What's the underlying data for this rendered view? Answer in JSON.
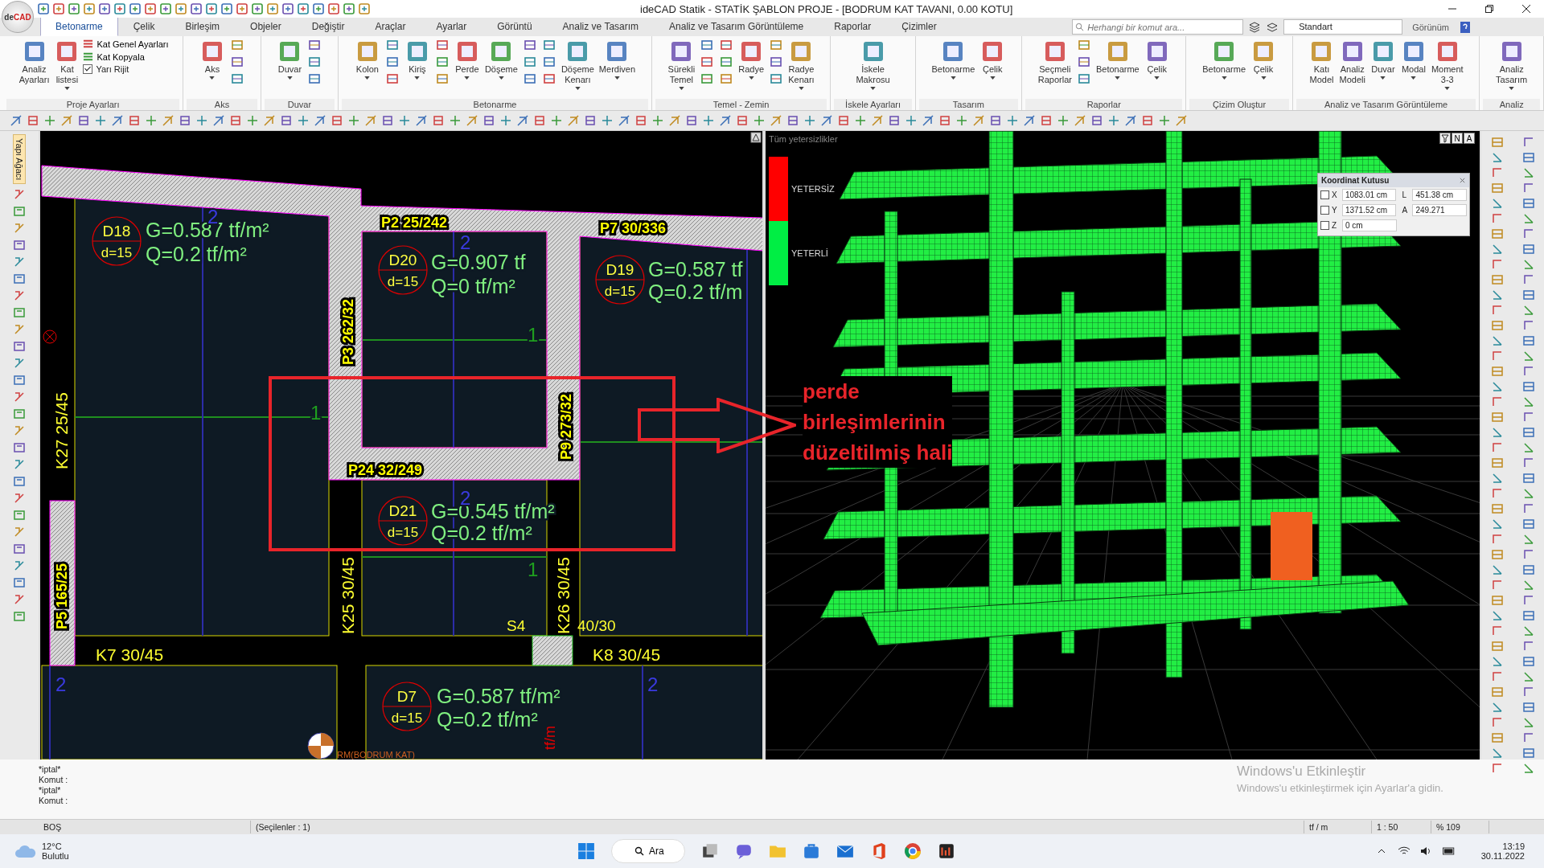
{
  "title_bar": {
    "logo": {
      "prefix": "de",
      "name": "CAD"
    },
    "title": "ideCAD Statik - STATİK ŞABLON PROJE - [BODRUM KAT TAVANI,  0.00 KOTU]"
  },
  "tabs": [
    {
      "label": "Betonarme",
      "selected": true
    },
    {
      "label": "Çelik",
      "selected": false
    },
    {
      "label": "Birleşim",
      "selected": false
    },
    {
      "label": "Objeler",
      "selected": false
    },
    {
      "label": "Değiştir",
      "selected": false
    },
    {
      "label": "Araçlar",
      "selected": false
    },
    {
      "label": "Ayarlar",
      "selected": false
    },
    {
      "label": "Görüntü",
      "selected": false
    },
    {
      "label": "Analiz ve Tasarım",
      "selected": false
    },
    {
      "label": "Analiz ve Tasarım Görüntüleme",
      "selected": false
    },
    {
      "label": "Raporlar",
      "selected": false
    },
    {
      "label": "Çizimler",
      "selected": false
    }
  ],
  "search": {
    "placeholder": "Herhangi bir komut ara..."
  },
  "style_combo": {
    "value": "Standart"
  },
  "view_menu": {
    "label": "Görünüm"
  },
  "ribbon": [
    {
      "label": "Proje Ayarları",
      "items": [
        {
          "kind": "large",
          "label": "Analiz\nAyarları",
          "dropdown": false
        },
        {
          "kind": "large",
          "label": "Kat\nlistesi",
          "dropdown": true
        },
        {
          "kind": "stack",
          "entries": [
            {
              "kind": "small",
              "label": "Kat Genel Ayarları"
            },
            {
              "kind": "small",
              "label": "Kat Kopyala"
            },
            {
              "kind": "check",
              "label": "Yarı Rijit",
              "checked": true
            }
          ]
        }
      ]
    },
    {
      "label": "Aks",
      "items": [
        {
          "kind": "large",
          "label": "Aks",
          "dropdown": true
        },
        {
          "kind": "icons"
        }
      ]
    },
    {
      "label": "Duvar",
      "items": [
        {
          "kind": "large",
          "label": "Duvar",
          "dropdown": true
        },
        {
          "kind": "icons"
        }
      ]
    },
    {
      "label": "Betonarme",
      "items": [
        {
          "kind": "large",
          "label": "Kolon",
          "dropdown": true
        },
        {
          "kind": "icons"
        },
        {
          "kind": "large",
          "label": "Kiriş",
          "dropdown": true
        },
        {
          "kind": "icons"
        },
        {
          "kind": "large",
          "label": "Perde",
          "dropdown": true
        },
        {
          "kind": "large",
          "label": "Döşeme",
          "dropdown": true
        },
        {
          "kind": "icons"
        },
        {
          "kind": "icons"
        },
        {
          "kind": "large",
          "label": "Döşeme\nKenarı",
          "dropdown": true
        },
        {
          "kind": "large",
          "label": "Merdiven",
          "dropdown": true
        }
      ]
    },
    {
      "label": "Temel - Zemin",
      "items": [
        {
          "kind": "large",
          "label": "Sürekli\nTemel",
          "dropdown": true
        },
        {
          "kind": "icons"
        },
        {
          "kind": "icons"
        },
        {
          "kind": "large",
          "label": "Radye",
          "dropdown": true
        },
        {
          "kind": "icons"
        },
        {
          "kind": "large",
          "label": "Radye\nKenarı",
          "dropdown": true
        }
      ]
    },
    {
      "label": "İskele Ayarları",
      "items": [
        {
          "kind": "large",
          "label": "İskele\nMakrosu",
          "dropdown": true
        }
      ]
    },
    {
      "label": "Tasarım",
      "items": [
        {
          "kind": "large",
          "label": "Betonarme",
          "dropdown": true
        },
        {
          "kind": "large",
          "label": "Çelik",
          "dropdown": true
        }
      ]
    },
    {
      "label": "Raporlar",
      "items": [
        {
          "kind": "large",
          "label": "Seçmeli\nRaporlar",
          "dropdown": false
        },
        {
          "kind": "icons"
        },
        {
          "kind": "large",
          "label": "Betonarme",
          "dropdown": true
        },
        {
          "kind": "large",
          "label": "Çelik",
          "dropdown": true
        }
      ]
    },
    {
      "label": "Çizim Oluştur",
      "items": [
        {
          "kind": "large",
          "label": "Betonarme",
          "dropdown": true
        },
        {
          "kind": "large",
          "label": "Çelik",
          "dropdown": true
        }
      ]
    },
    {
      "label": "Analiz ve Tasarım Görüntüleme",
      "items": [
        {
          "kind": "large",
          "label": "Katı\nModel",
          "dropdown": false
        },
        {
          "kind": "large",
          "label": "Analiz\nModeli",
          "dropdown": false
        },
        {
          "kind": "large",
          "label": "Duvar",
          "dropdown": true
        },
        {
          "kind": "large",
          "label": "Modal",
          "dropdown": true
        },
        {
          "kind": "large",
          "label": "Moment\n3-3",
          "dropdown": true
        }
      ]
    },
    {
      "label": "Analiz",
      "items": [
        {
          "kind": "large",
          "label": "Analiz\nTasarım",
          "dropdown": true
        }
      ]
    }
  ],
  "side_tab": {
    "label": "Yapı Ağacı"
  },
  "plan_view": {
    "slabs": [
      {
        "id": "D18",
        "thickness": "d=15",
        "g": "G=0.587 tf/m²",
        "q": "Q=0.2 tf/m²"
      },
      {
        "id": "D20",
        "thickness": "d=15",
        "g": "G=0.907 tf",
        "q": "Q=0 tf/m²"
      },
      {
        "id": "D19",
        "thickness": "d=15",
        "g": "G=0.587 tf",
        "q": "Q=0.2 tf/m"
      },
      {
        "id": "D21",
        "thickness": "d=15",
        "g": "G=0.545 tf/m²",
        "q": "Q=0.2 tf/m²"
      },
      {
        "id": "D7",
        "thickness": "d=15",
        "g": "G=0.587 tf/m²",
        "q": "Q=0.2 tf/m²"
      }
    ],
    "beams": [
      "K27 25/45",
      "K25 30/45",
      "K26 30/45",
      "K7 30/45",
      "K8 30/45"
    ],
    "walls": [
      "P2 25/242",
      "P7 30/336",
      "P3 262/32",
      "P9 273/32",
      "P24 32/249",
      "P5 165/25"
    ],
    "labels": [
      "S4",
      "40/30"
    ],
    "span_marks": [
      "2",
      "2",
      "1",
      "1",
      "2",
      "1",
      "2",
      "2"
    ],
    "unit_label": "tf/m",
    "floor_label": "RM(BODRUM KAT)"
  },
  "model_view": {
    "title": "Tüm yetersizlikler",
    "legend": [
      {
        "label": "YETERSİZ",
        "color": "#ff0000"
      },
      {
        "label": "YETERLİ",
        "color": "#00ee44"
      }
    ],
    "view_buttons": [
      "N",
      "A"
    ],
    "annotation": "perde\nbirleşimlerinin\ndüzeltilmiş hali"
  },
  "coordinate_box": {
    "title": "Koordinat Kutusu",
    "rows": [
      {
        "axis": "X",
        "checked": false,
        "value": "1083.01 cm",
        "extra_label": "L",
        "extra_value": "451.38 cm"
      },
      {
        "axis": "Y",
        "checked": false,
        "value": "1371.52 cm",
        "extra_label": "A",
        "extra_value": "249.271"
      },
      {
        "axis": "Z",
        "checked": false,
        "value": "0 cm"
      }
    ]
  },
  "command_lines": [
    "*iptal*",
    "Komut :",
    "*iptal*",
    "Komut :"
  ],
  "activation_notice": {
    "title": "Windows'u Etkinleştir",
    "text": "Windows'u etkinleştirmek için Ayarlar'a gidin."
  },
  "status_bar": {
    "mode": "BOŞ",
    "selection": "(Seçilenler : 1)",
    "unit": "tf / m",
    "scale": "1 : 50",
    "zoom": "% 109"
  },
  "taskbar": {
    "temperature": "12°C",
    "weather": "Bulutlu",
    "search": "Ara",
    "time": "13:19",
    "date": "30.11.2022"
  }
}
